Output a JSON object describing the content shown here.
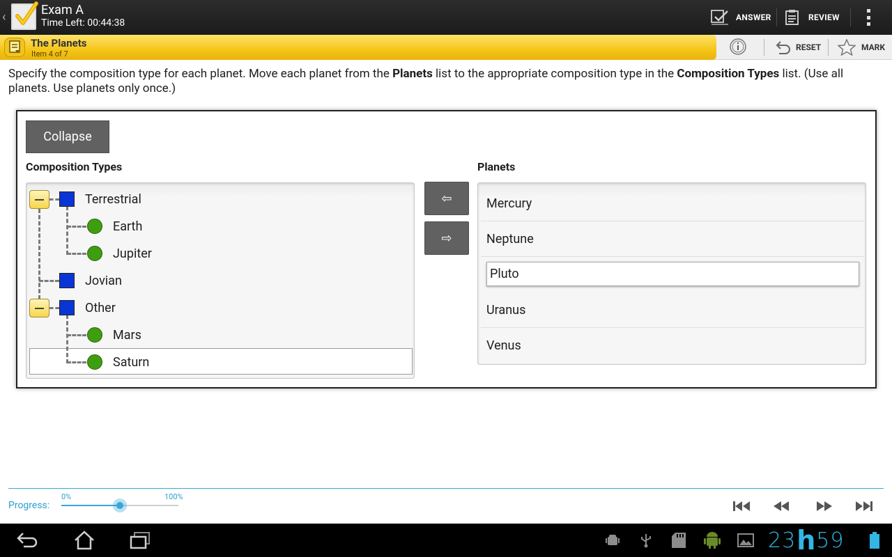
{
  "app": {
    "title": "Exam A",
    "time_left": "Time Left: 00:44:38"
  },
  "actions": {
    "answer": "ANSWER",
    "review": "REVIEW",
    "reset": "RESET",
    "mark": "MARK"
  },
  "item": {
    "title": "The Planets",
    "subtitle": "Item 4 of 7"
  },
  "instructions": {
    "part1": "Specify the composition type for each planet. Move each planet from the ",
    "bold1": "Planets",
    "part2": " list to the appropriate composition type in the ",
    "bold2": "Composition Types",
    "part3": " list. (Use all planets. Use planets only once.)"
  },
  "panel": {
    "collapse_label": "Collapse",
    "composition_header": "Composition Types",
    "planets_header": "Planets",
    "move_left_symbol": "⇦",
    "move_right_symbol": "⇨"
  },
  "tree": {
    "groups": [
      {
        "label": "Terrestrial",
        "children": [
          "Earth",
          "Jupiter"
        ]
      },
      {
        "label": "Jovian",
        "children": []
      },
      {
        "label": "Other",
        "children": [
          "Mars",
          "Saturn"
        ]
      }
    ],
    "selected": "Saturn"
  },
  "planets_list": {
    "items": [
      "Mercury",
      "Neptune",
      "Pluto",
      "Uranus",
      "Venus"
    ],
    "selected": "Pluto"
  },
  "progress": {
    "label": "Progress:",
    "min_label": "0%",
    "max_label": "100%",
    "value_fraction": 0.5
  },
  "system": {
    "clock_hours": "23",
    "clock_separator": "h",
    "clock_minutes": "59",
    "accent_color": "#33b5e5"
  }
}
